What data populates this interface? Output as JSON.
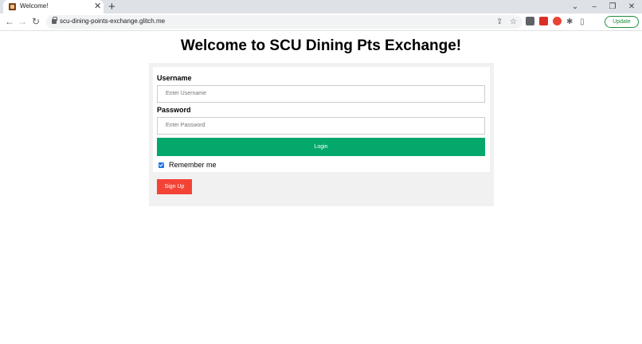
{
  "browser": {
    "tab_title": "Welcome!",
    "tab_close": "✕",
    "new_tab": "+",
    "url": "scu-dining-points-exchange.glitch.me",
    "update_label": "Update",
    "icons": {
      "back": "←",
      "forward": "→",
      "reload": "↻",
      "share": "⇪",
      "star": "☆",
      "puzzle": "✱",
      "sidepanel": "▯",
      "dropdown": "⌄",
      "minimize": "–",
      "restore": "❐",
      "close": "✕"
    }
  },
  "page": {
    "heading": "Welcome to SCU Dining Pts Exchange!",
    "form": {
      "username_label": "Username",
      "username_placeholder": "Enter Username",
      "password_label": "Password",
      "password_placeholder": "Enter Password",
      "login_label": "Login",
      "remember_label": "Remember me",
      "remember_checked": true,
      "signup_label": "Sign Up"
    }
  },
  "colors": {
    "login_button": "#04a86b",
    "signup_button": "#f44336",
    "panel_background": "#f1f1f1"
  }
}
